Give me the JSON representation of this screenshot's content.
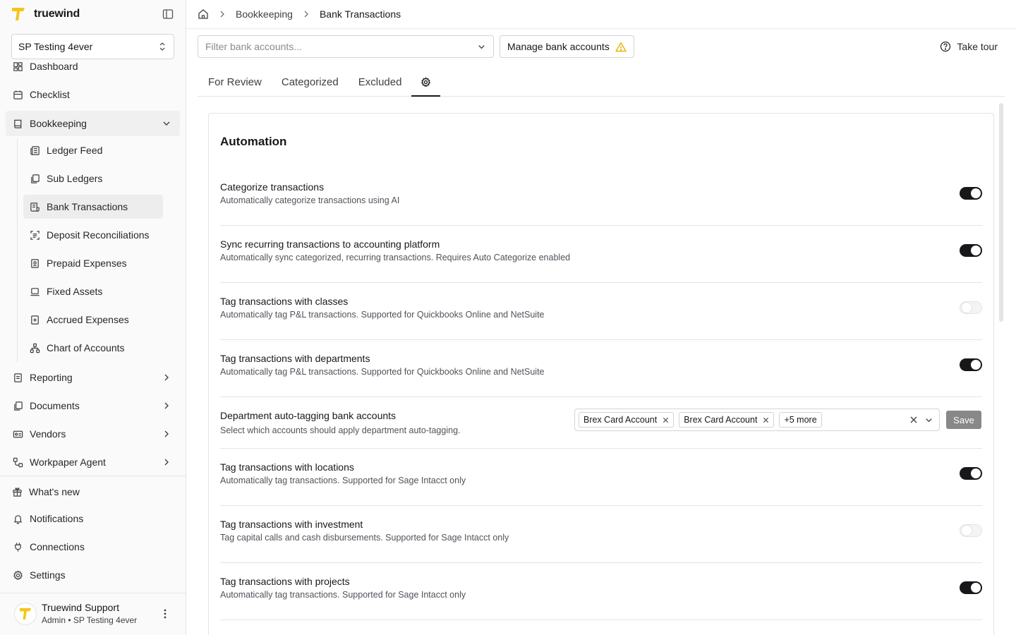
{
  "app": {
    "name": "truewind"
  },
  "org_select": {
    "value": "SP Testing 4ever"
  },
  "nav": {
    "dashboard": "Dashboard",
    "checklist": "Checklist",
    "bookkeeping": "Bookkeeping",
    "sub_items": [
      "Ledger Feed",
      "Sub Ledgers",
      "Bank Transactions",
      "Deposit Reconciliations",
      "Prepaid Expenses",
      "Fixed Assets",
      "Accrued Expenses",
      "Chart of Accounts"
    ],
    "reporting": "Reporting",
    "documents": "Documents",
    "vendors": "Vendors",
    "workpaper_agent": "Workpaper Agent",
    "whats_new": "What's new",
    "notifications": "Notifications",
    "connections": "Connections",
    "settings": "Settings"
  },
  "user": {
    "name": "Truewind Support",
    "role": "Admin • SP Testing 4ever"
  },
  "breadcrumb": {
    "items": [
      "Bookkeeping",
      "Bank Transactions"
    ]
  },
  "toolbar": {
    "filter_placeholder": "Filter bank accounts...",
    "manage_label": "Manage bank accounts",
    "tour_label": "Take tour"
  },
  "tabs": [
    "For Review",
    "Categorized",
    "Excluded"
  ],
  "automation": {
    "title": "Automation",
    "rows": [
      {
        "title": "Categorize transactions",
        "desc": "Automatically categorize transactions using AI",
        "enabled": true
      },
      {
        "title": "Sync recurring transactions to accounting platform",
        "desc": "Automatically sync categorized, recurring transactions. Requires Auto Categorize enabled",
        "enabled": true
      },
      {
        "title": "Tag transactions with classes",
        "desc": "Automatically tag P&L transactions. Supported for Quickbooks Online and NetSuite",
        "enabled": false
      },
      {
        "title": "Tag transactions with departments",
        "desc": "Automatically tag P&L transactions. Supported for Quickbooks Online and NetSuite",
        "enabled": true
      },
      {
        "title": "Tag transactions with locations",
        "desc": "Automatically tag transactions. Supported for Sage Intacct only",
        "enabled": true
      },
      {
        "title": "Tag transactions with investment",
        "desc": "Tag capital calls and cash disbursements. Supported for Sage Intacct only",
        "enabled": false
      },
      {
        "title": "Tag transactions with projects",
        "desc": "Automatically tag transactions. Supported for Sage Intacct only",
        "enabled": true
      }
    ],
    "dept_accounts": {
      "title": "Department auto-tagging bank accounts",
      "desc": "Select which accounts should apply department auto-tagging.",
      "chips": [
        "Brex Card Account",
        "Brex Card Account"
      ],
      "more": "+5 more",
      "save_label": "Save"
    }
  },
  "colors": {
    "brand": "#f5c518",
    "accent": "#18181b",
    "warning": "#eab308",
    "save_disabled": "#888888"
  }
}
